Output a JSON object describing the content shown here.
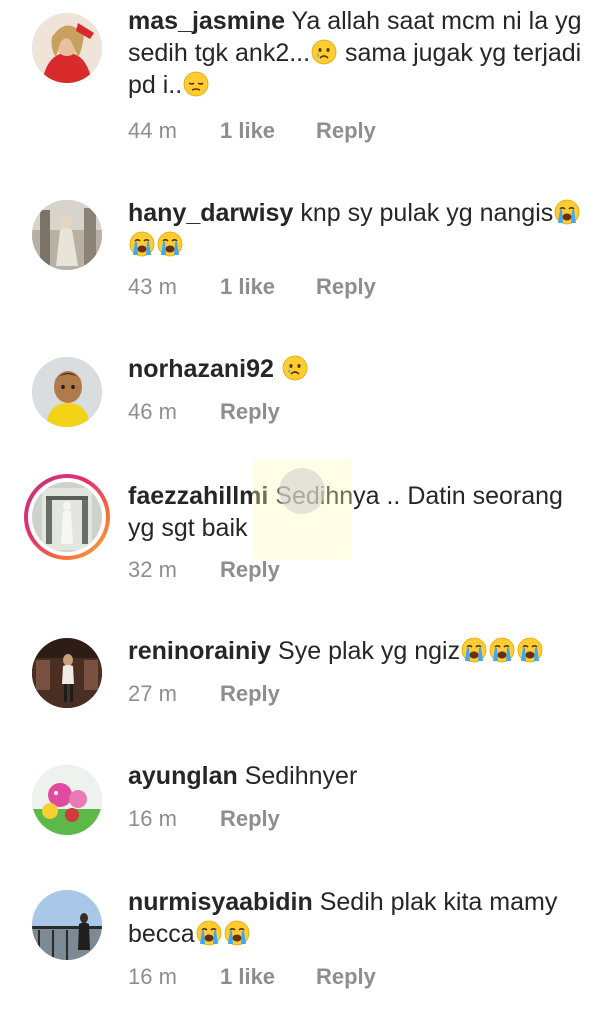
{
  "comments": [
    {
      "username": "mas_jasmine",
      "text_parts": [
        "Ya allah saat mcm ni la yg sedih tgk ank2...",
        " sama jugak yg terjadi pd i..",
        ""
      ],
      "emojis": [
        "crying-face",
        "pensive-face"
      ],
      "time": "44 m",
      "likes": "1 like",
      "reply": "Reply"
    },
    {
      "username": "hany_darwisy",
      "text": "knp sy pulak yg nangis",
      "emojis": [
        "loudly-crying-face",
        "loudly-crying-face",
        "loudly-crying-face"
      ],
      "time": "43 m",
      "likes": "1 like",
      "reply": "Reply"
    },
    {
      "username": "norhazani92",
      "text": "",
      "emojis": [
        "crying-face"
      ],
      "time": "46 m",
      "reply": "Reply"
    },
    {
      "username": "faezzahillmi",
      "text": "Sedihnya .. Datin seorang yg sgt baik",
      "time": "32 m",
      "reply": "Reply"
    },
    {
      "username": "reninorainiy",
      "text": "Sye plak yg ngiz",
      "emojis": [
        "loudly-crying-face",
        "loudly-crying-face",
        "loudly-crying-face"
      ],
      "time": "27 m",
      "reply": "Reply"
    },
    {
      "username": "ayunglan",
      "text": "Sedihnyer",
      "time": "16 m",
      "reply": "Reply"
    },
    {
      "username": "nurmisyaabidin",
      "text": "Sedih plak kita mamy becca",
      "emojis": [
        "loudly-crying-face",
        "loudly-crying-face"
      ],
      "time": "16 m",
      "likes": "1 like",
      "reply": "Reply"
    }
  ],
  "colors": {
    "username": "#262626",
    "meta": "#8e8e8e",
    "story_ring": [
      "#c13584",
      "#f77737",
      "#fcaf45"
    ]
  }
}
